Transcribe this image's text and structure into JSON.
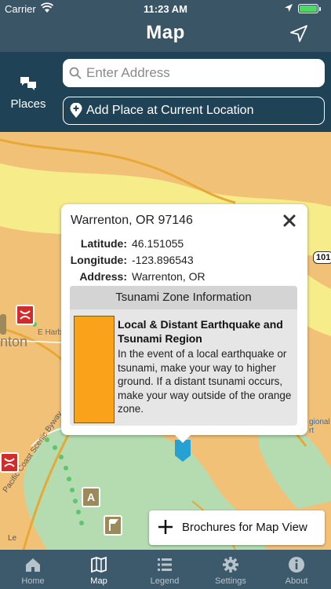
{
  "status_bar": {
    "carrier": "Carrier",
    "time": "11:23 AM"
  },
  "nav": {
    "title": "Map"
  },
  "search": {
    "places_label": "Places",
    "placeholder": "Enter Address",
    "add_place_label": "Add Place at Current Location"
  },
  "map": {
    "labels": {
      "town_fragment": "nton",
      "street": "E Harb",
      "byway": "Pacific Coast Scenic Byway",
      "route_101": "101",
      "regional_airport": "gional\nrt",
      "legal": "Le"
    },
    "marker_letter": "A"
  },
  "popup": {
    "title": "Warrenton, OR  97146",
    "latitude_label": "Latitude:",
    "latitude": "46.151055",
    "longitude_label": "Longitude:",
    "longitude": "-123.896543",
    "address_label": "Address:",
    "address": "Warrenton, OR",
    "zone_header": "Tsunami Zone Information",
    "zone_title": "Local & Distant Earthquake and Tsunami Region",
    "zone_description": "In the event of a local earthquake or tsunami, make your way to higher ground. If a distant tsunami occurs, make your way outside of the orange zone.",
    "zone_color": "#f9a21a"
  },
  "brochures_label": "Brochures for Map View",
  "tabs": [
    {
      "label": "Home",
      "icon": "home-icon",
      "active": false
    },
    {
      "label": "Map",
      "icon": "map-icon",
      "active": true
    },
    {
      "label": "Legend",
      "icon": "legend-icon",
      "active": false
    },
    {
      "label": "Settings",
      "icon": "gear-icon",
      "active": false
    },
    {
      "label": "About",
      "icon": "info-icon",
      "active": false
    }
  ],
  "colors": {
    "header": "#3a5566",
    "search_panel": "#1f4256",
    "tab_bar": "#3d5a6c",
    "map_land": "#f2c178",
    "map_green": "#b4dcb0",
    "map_yellow": "#f6ec8a"
  }
}
